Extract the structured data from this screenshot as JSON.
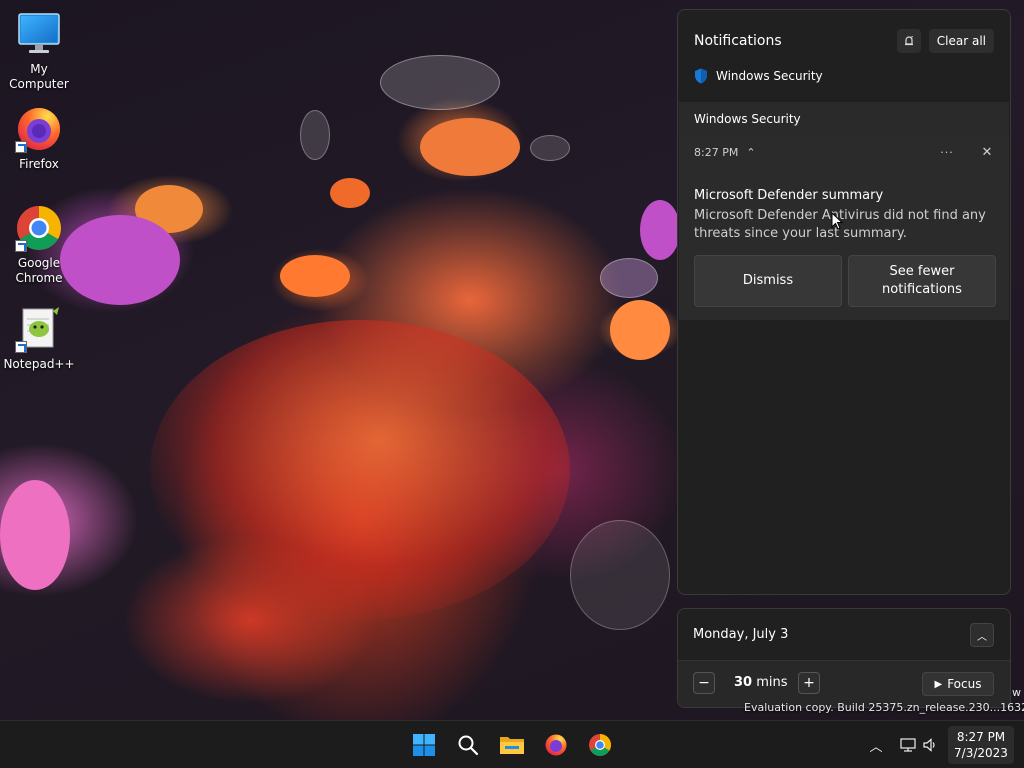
{
  "desktop": {
    "icons": [
      {
        "label": "My Computer",
        "icon": "monitor-icon"
      },
      {
        "label": "Firefox",
        "icon": "firefox-icon"
      },
      {
        "label": "Google Chrome",
        "icon": "chrome-icon"
      },
      {
        "label": "Notepad++",
        "icon": "notepad-plus-plus-icon"
      }
    ],
    "watermark": "Evaluation copy. Build 25375.zn_release.230...1632",
    "watermark_edge": "w"
  },
  "notifications": {
    "title": "Notifications",
    "clear_all_label": "Clear all",
    "app_name": "Windows Security",
    "group_header": "Windows Security",
    "toast": {
      "time": "8:27 PM",
      "title": "Microsoft Defender summary",
      "body": "Microsoft Defender Antivirus did not find any threats since your last summary.",
      "dismiss_label": "Dismiss",
      "fewer_label": "See fewer notifications"
    }
  },
  "calendar": {
    "date": "Monday, July 3",
    "focus_value": "30",
    "focus_unit": "mins",
    "focus_label": "Focus"
  },
  "taskbar": {
    "apps": [
      "start-icon",
      "search-icon",
      "file-explorer-icon",
      "firefox-icon",
      "chrome-icon"
    ],
    "clock_time": "8:27 PM",
    "clock_date": "7/3/2023"
  },
  "colors": {
    "accent": "#0078d4",
    "panel_bg": "#202020",
    "taskbar_bg": "#1c1c1c"
  }
}
